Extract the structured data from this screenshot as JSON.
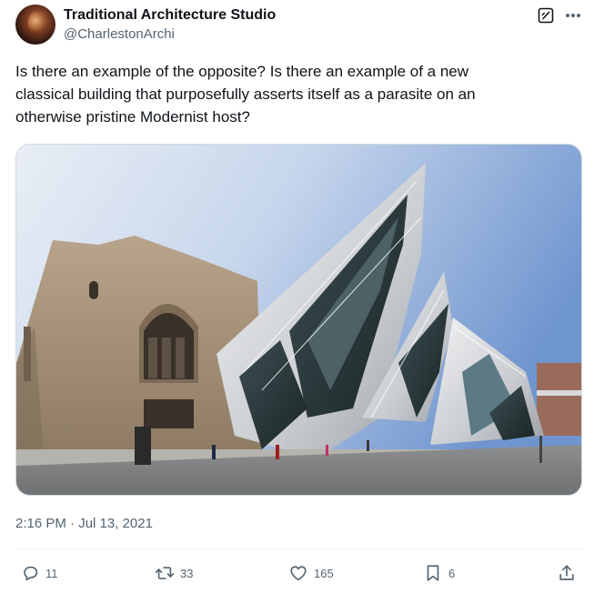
{
  "tweet": {
    "author": {
      "display_name": "Traditional Architecture Studio",
      "handle": "@CharlestonArchi"
    },
    "text": "Is there an example of the opposite? Is there an example of a new\nclassical building that purposefully asserts itself as a parasite on an\notherwise pristine Modernist host?",
    "timestamp": "2:16 PM · Jul 13, 2021",
    "media": {
      "subject": "photo-stone-building-with-crystal-addition"
    },
    "metrics": {
      "replies": "11",
      "reposts": "33",
      "likes": "165",
      "bookmarks": "6"
    }
  },
  "icons": {
    "grok": "grok-icon",
    "more": "more-icon",
    "reply": "reply-icon",
    "repost": "repost-icon",
    "like": "heart-icon",
    "bookmark": "bookmark-icon",
    "share": "share-icon"
  },
  "colors": {
    "text_primary": "#0f1419",
    "text_secondary": "#536471",
    "border": "#cfd9de",
    "divider": "#eff3f4"
  }
}
